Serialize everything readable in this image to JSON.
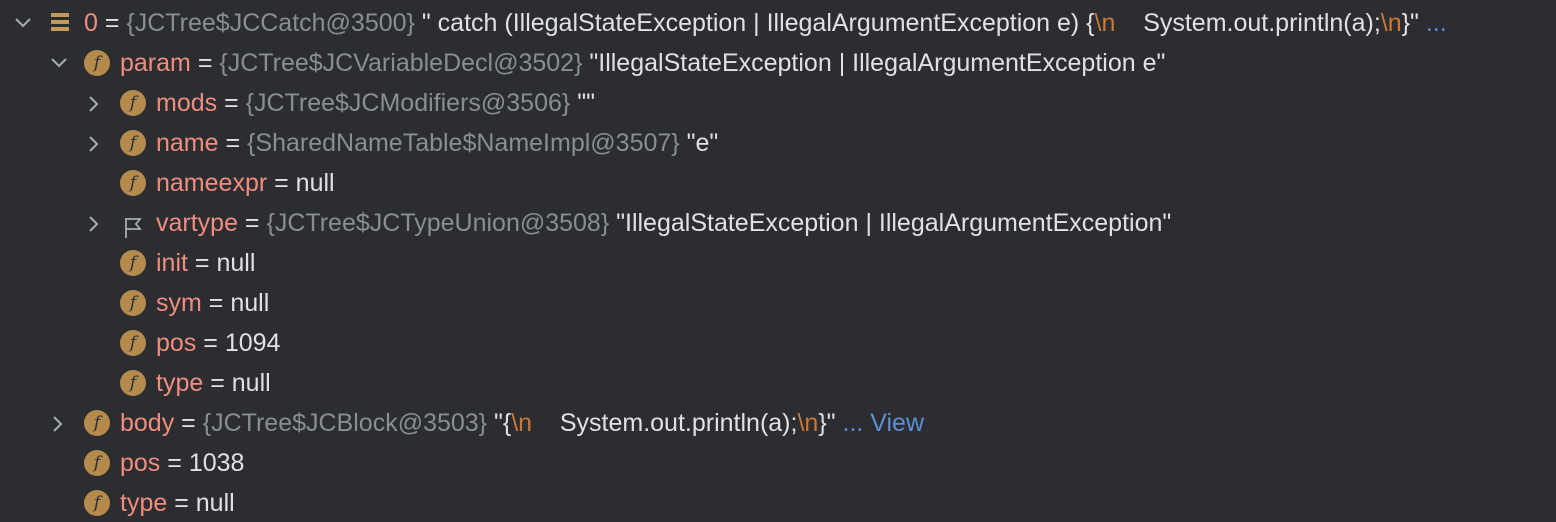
{
  "eq": " = ",
  "nodes": [
    {
      "icon": "array",
      "name": "0",
      "ref": "{JCTree$JCCatch@3500}",
      "value": [
        {
          "t": "str",
          "v": " \" catch (IllegalStateException | IllegalArgumentException e) {"
        },
        {
          "t": "esc",
          "v": "\\n"
        },
        {
          "t": "str",
          "v": "    System.out.println(a);"
        },
        {
          "t": "esc",
          "v": "\\n"
        },
        {
          "t": "str",
          "v": "}\""
        },
        {
          "t": "view",
          "v": " ..."
        }
      ]
    },
    {
      "icon": "field",
      "name": "param",
      "ref": "{JCTree$JCVariableDecl@3502}",
      "value": [
        {
          "t": "str",
          "v": " \"IllegalStateException | IllegalArgumentException e\""
        }
      ]
    },
    {
      "icon": "field",
      "name": "mods",
      "ref": "{JCTree$JCModifiers@3506}",
      "value": [
        {
          "t": "str",
          "v": " \"\""
        }
      ]
    },
    {
      "icon": "field",
      "name": "name",
      "ref": "{SharedNameTable$NameImpl@3507}",
      "value": [
        {
          "t": "str",
          "v": " \"e\""
        }
      ]
    },
    {
      "icon": "field",
      "name": "nameexpr",
      "ref": "",
      "value": [
        {
          "t": "str",
          "v": "null"
        }
      ]
    },
    {
      "icon": "flag",
      "name": "vartype",
      "ref": "{JCTree$JCTypeUnion@3508}",
      "value": [
        {
          "t": "str",
          "v": " \"IllegalStateException | IllegalArgumentException\""
        }
      ]
    },
    {
      "icon": "field",
      "name": "init",
      "ref": "",
      "value": [
        {
          "t": "str",
          "v": "null"
        }
      ]
    },
    {
      "icon": "field",
      "name": "sym",
      "ref": "",
      "value": [
        {
          "t": "str",
          "v": "null"
        }
      ]
    },
    {
      "icon": "field",
      "name": "pos",
      "ref": "",
      "value": [
        {
          "t": "str",
          "v": "1094"
        }
      ]
    },
    {
      "icon": "field",
      "name": "type",
      "ref": "",
      "value": [
        {
          "t": "str",
          "v": "null"
        }
      ]
    },
    {
      "icon": "field",
      "name": "body",
      "ref": "{JCTree$JCBlock@3503}",
      "value": [
        {
          "t": "str",
          "v": " \"{"
        },
        {
          "t": "esc",
          "v": "\\n"
        },
        {
          "t": "str",
          "v": "    System.out.println(a);"
        },
        {
          "t": "esc",
          "v": "\\n"
        },
        {
          "t": "str",
          "v": "}\""
        },
        {
          "t": "view",
          "v": " ... View"
        }
      ]
    },
    {
      "icon": "field",
      "name": "pos",
      "ref": "",
      "value": [
        {
          "t": "str",
          "v": "1038"
        }
      ]
    },
    {
      "icon": "field",
      "name": "type",
      "ref": "",
      "value": [
        {
          "t": "str",
          "v": "null"
        }
      ]
    }
  ]
}
